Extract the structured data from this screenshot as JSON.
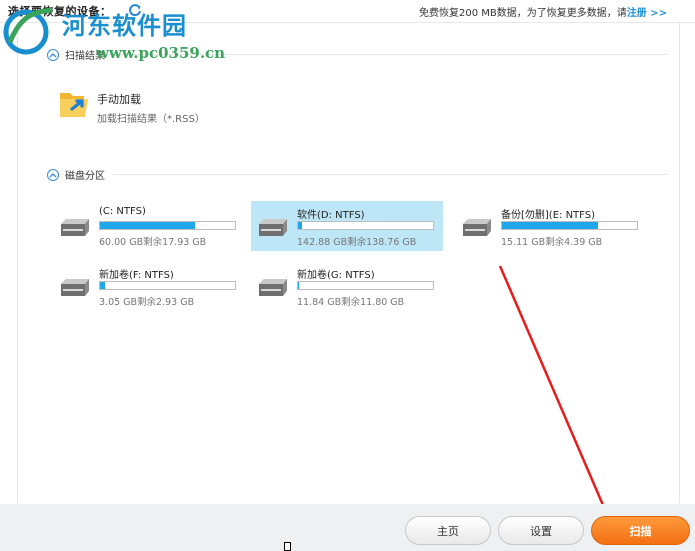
{
  "header": {
    "title": "选择要恢复的设备：",
    "notice_text": "免费恢复200 MB数据，为了恢复更多数据，请",
    "register_link": "注册 >>"
  },
  "watermark": {
    "site_name": "河东软件园",
    "url": "www.pc0359.cn"
  },
  "scan_results_section": {
    "title": "扫描结果",
    "manual_load": {
      "title": "手动加载",
      "subtitle": "加载扫描结果（*.RSS）"
    }
  },
  "partition_section": {
    "title": "磁盘分区",
    "drives": [
      {
        "name": "(C: NTFS)",
        "size_text": "60.00 GB剩余17.93 GB",
        "used_fraction": 0.7,
        "selected": false
      },
      {
        "name": "软件(D: NTFS)",
        "size_text": "142.88 GB剩余138.76 GB",
        "used_fraction": 0.03,
        "selected": true
      },
      {
        "name": "备份[勿删](E: NTFS)",
        "size_text": "15.11 GB剩余4.39 GB",
        "used_fraction": 0.71,
        "selected": false
      },
      {
        "name": "新加卷(F: NTFS)",
        "size_text": "3.05 GB剩余2.93 GB",
        "used_fraction": 0.04,
        "selected": false
      },
      {
        "name": "新加卷(G: NTFS)",
        "size_text": "11.84 GB剩余11.80 GB",
        "used_fraction": 0.01,
        "selected": false
      }
    ]
  },
  "footer": {
    "home_label": "主页",
    "settings_label": "设置",
    "scan_label": "扫描"
  },
  "colors": {
    "accent": "#1ea7ea",
    "selected_bg": "#bde6f6",
    "primary_button": "#f36f12",
    "annotation_arrow": "#e81c1c"
  }
}
